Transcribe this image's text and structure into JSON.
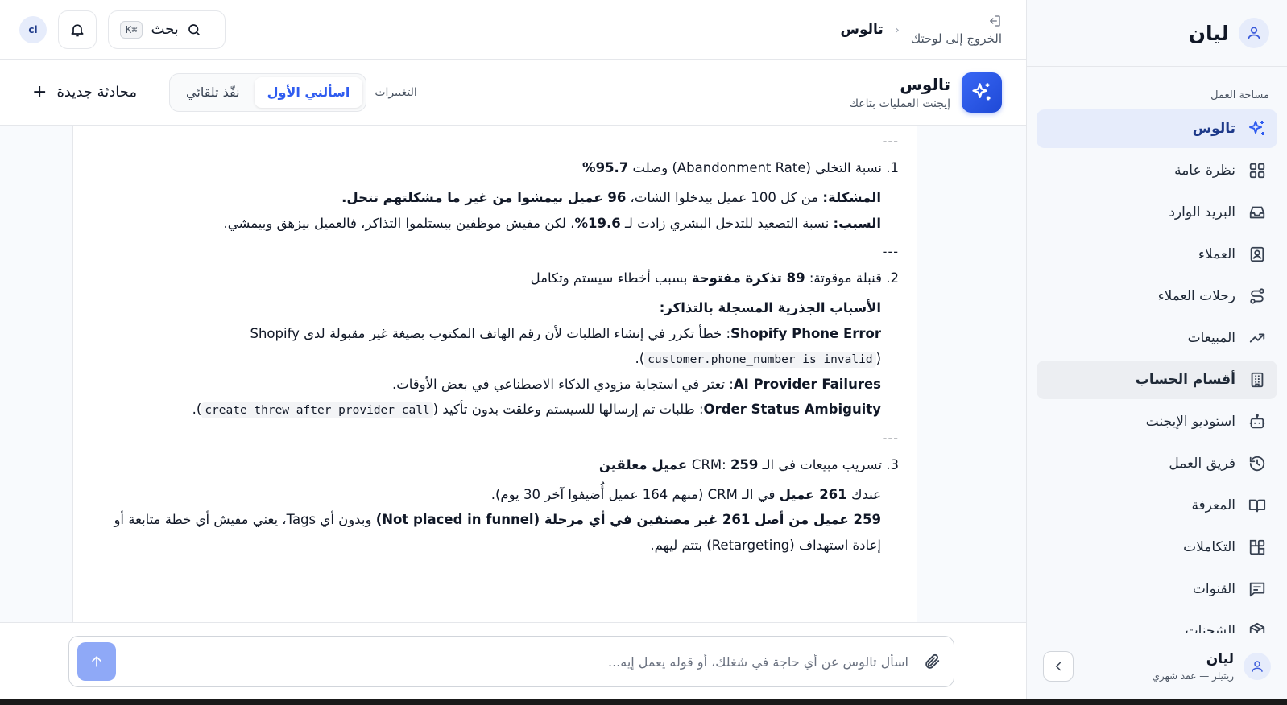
{
  "sidebar": {
    "brand": "ليان",
    "section_label": "مساحة العمل",
    "items": [
      {
        "label": "تالوس",
        "icon": "sparkles-icon"
      },
      {
        "label": "نظرة عامة",
        "icon": "grid-icon"
      },
      {
        "label": "البريد الوارد",
        "icon": "inbox-icon"
      },
      {
        "label": "العملاء",
        "icon": "contact-icon"
      },
      {
        "label": "رحلات العملاء",
        "icon": "route-icon"
      },
      {
        "label": "المبيعات",
        "icon": "trending-up-icon"
      },
      {
        "label": "أقسام الحساب",
        "icon": "building-icon"
      },
      {
        "label": "استوديو الإيجنت",
        "icon": "bot-icon"
      },
      {
        "label": "فريق العمل",
        "icon": "history-icon"
      },
      {
        "label": "المعرفة",
        "icon": "book-icon"
      },
      {
        "label": "التكاملات",
        "icon": "blocks-icon"
      },
      {
        "label": "القنوات",
        "icon": "message-square-icon"
      },
      {
        "label": "الشحنات",
        "icon": "package-icon"
      }
    ],
    "footer": {
      "name": "ليان",
      "plan": "ريتيلر — عقد شهري"
    }
  },
  "topbar": {
    "back_label": "الخروج إلى لوحتك",
    "crumb_current": "تالوس",
    "search_label": "بحث",
    "shortcut": "K⌘",
    "org_initials": "cl"
  },
  "agent": {
    "name": "تالوس",
    "description": "إيجنت العمليات بتاعك",
    "mode_label": "التغييرات",
    "mode_ask": "اسألني الأول",
    "mode_auto": "نفّذ تلقائي",
    "new_chat": "محادثة جديدة"
  },
  "message": {
    "sep": "---",
    "s1_pre": "1. نسبة التخلي (Abandonment Rate) وصلت ",
    "s1_bold": "95.7%",
    "s1_problem_label": "المشكلة:",
    "s1_problem_text": " من كل 100 عميل بيدخلوا الشات، ",
    "s1_problem_bold": "96 عميل بيمشوا من غير ما مشكلتهم تتحل.",
    "s1_cause_label": "السبب:",
    "s1_cause_text": " نسبة التصعيد للتدخل البشري زادت لـ ",
    "s1_cause_bold": "19.6%",
    "s1_cause_rest": "، لكن مفيش موظفين بيستلموا التذاكر، فالعميل بيزهق وبيمشي.",
    "s2_pre": "2. قنبلة موقوتة: ",
    "s2_bold": "89 تذكرة مفتوحة",
    "s2_rest": " بسبب أخطاء سيستم وتكامل",
    "s2_roots": "الأسباب الجذرية المسجلة بالتذاكر:",
    "s2_r1_label": "Shopify Phone Error",
    "s2_r1_text": ": خطأ تكرر في إنشاء الطلبات لأن رقم الهاتف المكتوب بصيغة غير مقبولة لدى Shopify (",
    "s2_r1_code": "customer.phone_number is invalid",
    "s2_r1_end": ").",
    "s2_r2_label": "AI Provider Failures",
    "s2_r2_text": ": تعثر في استجابة مزودي الذكاء الاصطناعي في بعض الأوقات.",
    "s2_r3_label": "Order Status Ambiguity",
    "s2_r3_text": ": طلبات تم إرسالها للسيستم وعلقت بدون تأكيد (",
    "s2_r3_code": "create threw after provider call",
    "s2_r3_end": ").",
    "s3_pre": "3. تسريب مبيعات في الـ CRM: ",
    "s3_bold": "259 عميل معلقين",
    "s3_l1_pre": "عندك ",
    "s3_l1_bold": "261 عميل",
    "s3_l1_rest": " في الـ CRM (منهم 164 عميل أُضيفوا آخر 30 يوم).",
    "s3_l2_bold": "259 عميل من أصل 261 غير مصنفين في أي مرحلة (Not placed in funnel)",
    "s3_l2_rest": " وبدون أي Tags، يعني مفيش أي خطة متابعة أو إعادة استهداف (Retargeting) بتتم ليهم."
  },
  "composer": {
    "placeholder": "اسأل تالوس عن أي حاجة في شغلك، أو قوله يعمل إيه..."
  },
  "colors": {
    "accent": "#2f5cf0",
    "active_bg": "#e6ecfb",
    "send_disabled": "#8fa9f7"
  }
}
